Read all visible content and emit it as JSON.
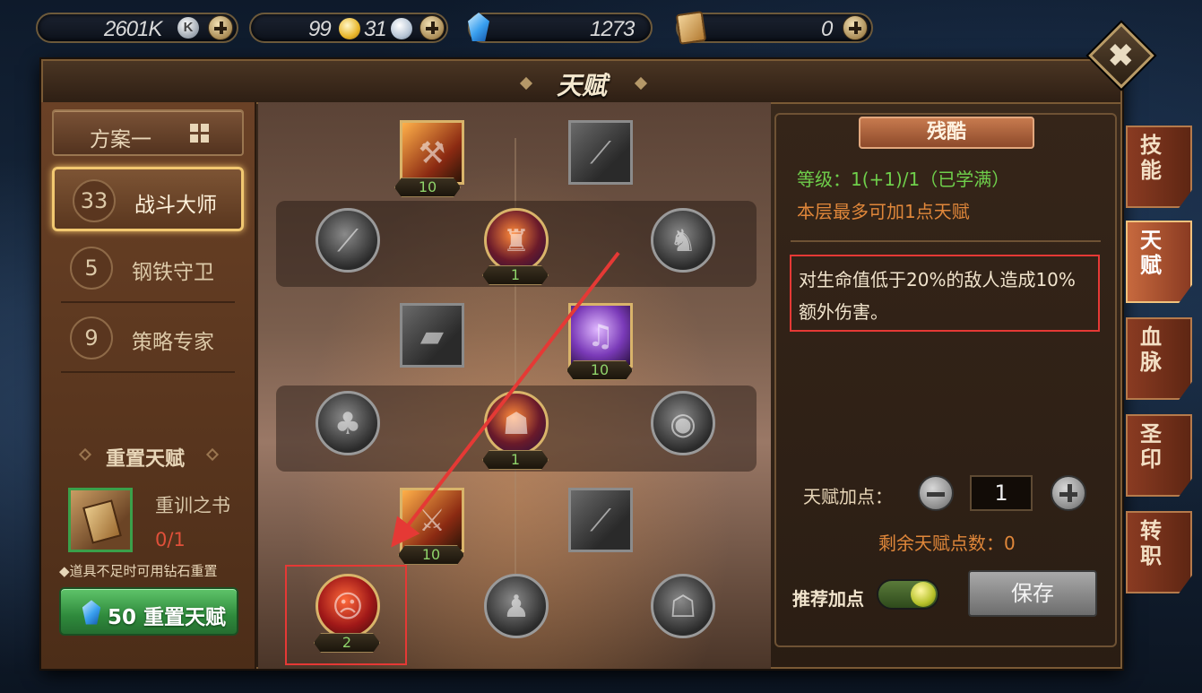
{
  "resources": {
    "k_currency": "2601K",
    "k_icon_letter": "K",
    "gold": "99",
    "silver": "31",
    "diamonds": "1273",
    "cards": "0"
  },
  "window": {
    "title": "天赋",
    "close_glyph": "✖"
  },
  "left": {
    "scheme_label": "方案一",
    "branches": [
      {
        "points": "33",
        "name": "战斗大师",
        "active": true
      },
      {
        "points": "5",
        "name": "钢铁守卫",
        "active": false
      },
      {
        "points": "9",
        "name": "策略专家",
        "active": false
      }
    ],
    "reset_title": "重置天赋",
    "book_name": "重训之书",
    "book_count": "0/1",
    "hint": "◆道具不足时可用钻石重置",
    "reset_button": "50 重置天赋"
  },
  "tree": {
    "levels": [
      "10",
      "1",
      "10",
      "1",
      "10",
      "2"
    ]
  },
  "info": {
    "talent_name": "残酷",
    "level_text": "等级：1(+1)/1（已学满）",
    "limit_text": "本层最多可加1点天赋",
    "description": "对生命值低于20%的敌人造成10%额外伤害。",
    "add_points_label": "天赋加点：",
    "add_points_value": "1",
    "remaining_text": "剩余天赋点数：0",
    "recommend_label": "推荐加点",
    "save_button": "保存"
  },
  "side_tabs": [
    {
      "label": "技能",
      "active": false
    },
    {
      "label": "天赋",
      "active": true
    },
    {
      "label": "血脉",
      "active": false
    },
    {
      "label": "圣印",
      "active": false
    },
    {
      "label": "转职",
      "active": false
    }
  ],
  "colors": {
    "accent_gold": "#f2c870",
    "level_green": "#6fcf4b",
    "warning_orange": "#e0873a",
    "highlight_red": "#e53935",
    "reset_green": "#2f8a3c"
  }
}
